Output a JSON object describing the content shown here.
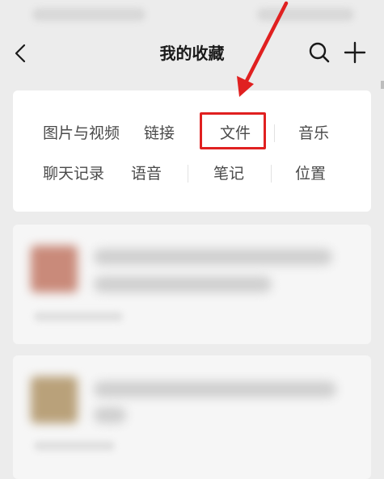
{
  "header": {
    "title": "我的收藏"
  },
  "categories": {
    "row1": [
      "图片与视频",
      "链接",
      "文件",
      "音乐"
    ],
    "row2": [
      "聊天记录",
      "语音",
      "笔记",
      "位置"
    ]
  },
  "annotation": {
    "color": "#e02020"
  },
  "icons": {
    "back": "chevron-left-icon",
    "search": "search-icon",
    "add": "plus-icon"
  }
}
